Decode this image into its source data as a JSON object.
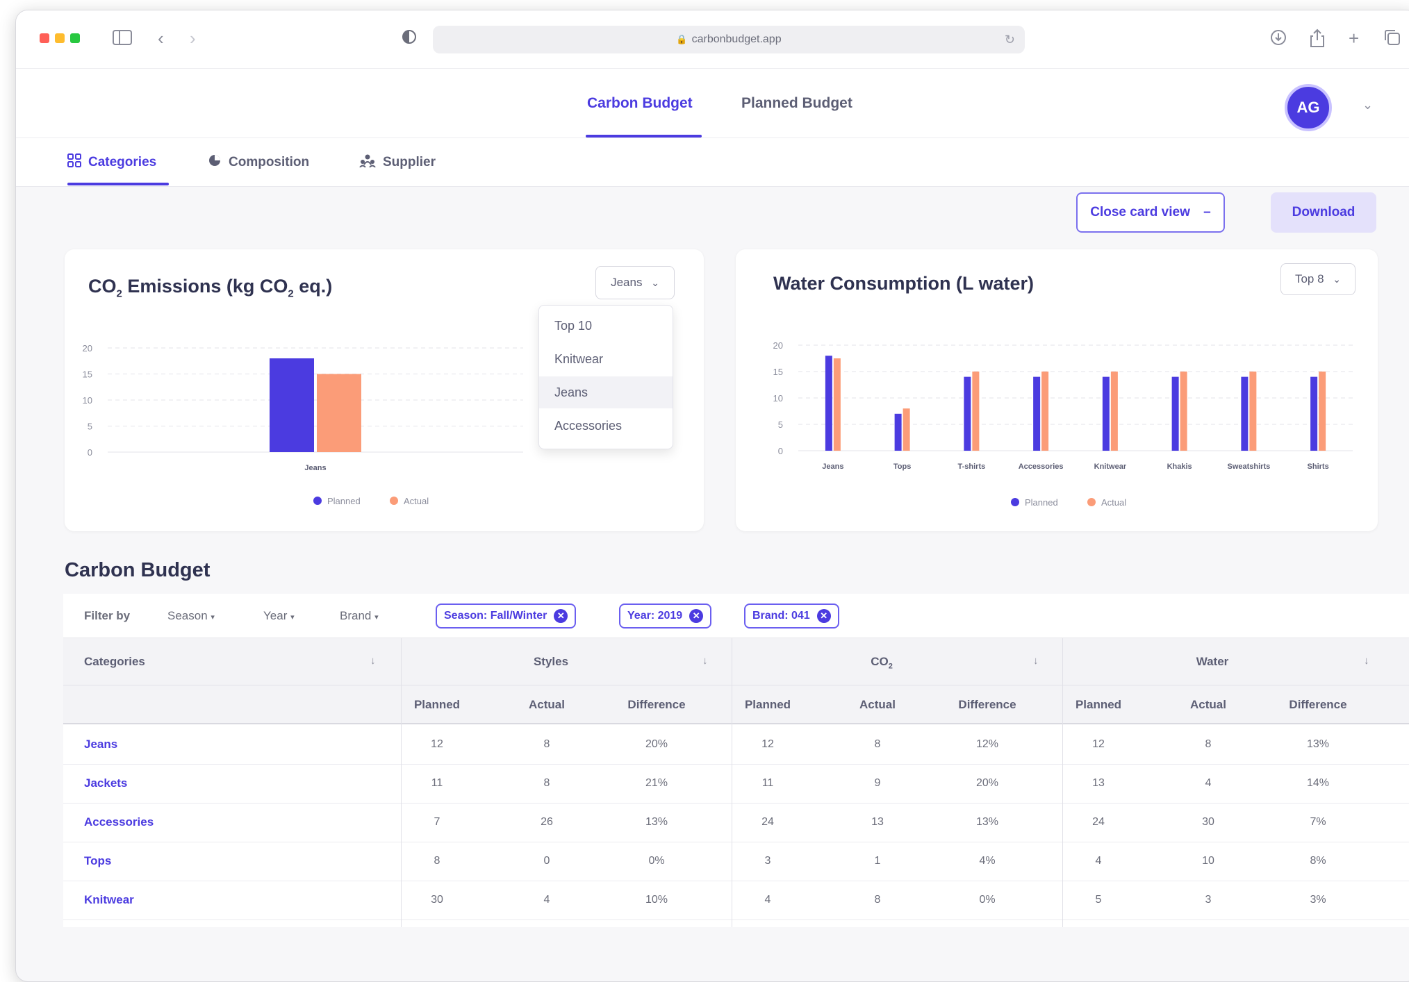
{
  "browser": {
    "url": "carbonbudget.app"
  },
  "app": {
    "nav": [
      "Carbon Budget",
      "Planned Budget"
    ],
    "avatar_initials": "AG",
    "subtabs": [
      "Categories",
      "Composition",
      "Supplier"
    ],
    "close_card_label": "Close card view",
    "download_label": "Download",
    "accent": "#4b3be0",
    "planned_color": "#4b3be0",
    "actual_color": "#fb9c78"
  },
  "co2_card": {
    "title_main": "CO",
    "title_sub": "2",
    "title_rest": " Emissions (kg CO",
    "title_sub2": "2",
    "title_end": " eq.)",
    "select_value": "Jeans",
    "dropdown": [
      "Top 10",
      "Knitwear",
      "Jeans",
      "Accessories"
    ],
    "legend": [
      "Planned",
      "Actual"
    ]
  },
  "water_card": {
    "title": "Water Consumption (L water)",
    "select_value": "Top 8",
    "legend": [
      "Planned",
      "Actual"
    ]
  },
  "chart_data": [
    {
      "type": "bar",
      "categories": [
        "Jeans"
      ],
      "series": [
        {
          "name": "Planned",
          "values": [
            18
          ]
        },
        {
          "name": "Actual",
          "values": [
            15
          ]
        }
      ],
      "ylim": [
        0,
        20
      ],
      "yticks": [
        0,
        5,
        10,
        15,
        20
      ],
      "legend": "bottom",
      "grid": true
    },
    {
      "type": "bar",
      "categories": [
        "Jeans",
        "Tops",
        "T-shirts",
        "Accessories",
        "Knitwear",
        "Khakis",
        "Sweatshirts",
        "Shirts"
      ],
      "series": [
        {
          "name": "Planned",
          "values": [
            18,
            7,
            14,
            14,
            14,
            14,
            14,
            14
          ]
        },
        {
          "name": "Actual",
          "values": [
            17.5,
            8,
            15,
            15,
            15,
            15,
            15,
            15
          ]
        }
      ],
      "ylim": [
        0,
        20
      ],
      "yticks": [
        0,
        5,
        10,
        15,
        20
      ],
      "legend": "bottom",
      "grid": true
    }
  ],
  "table": {
    "section_title": "Carbon Budget",
    "filter_label": "Filter by",
    "filters": [
      "Season",
      "Year",
      "Brand"
    ],
    "chips": [
      "Season: Fall/Winter",
      "Year: 2019",
      "Brand: 041"
    ],
    "group_headers": [
      "Categories",
      "Styles",
      "CO",
      "Water"
    ],
    "co2_sub": "2",
    "sub_headers": [
      "Planned",
      "Actual",
      "Difference"
    ],
    "rows": [
      {
        "category": "Jeans",
        "values": [
          "12",
          "8",
          "20%",
          "12",
          "8",
          "12%",
          "12",
          "8",
          "13%"
        ]
      },
      {
        "category": "Jackets",
        "values": [
          "11",
          "8",
          "21%",
          "11",
          "9",
          "20%",
          "13",
          "4",
          "14%"
        ]
      },
      {
        "category": "Accessories",
        "values": [
          "7",
          "26",
          "13%",
          "24",
          "13",
          "13%",
          "24",
          "30",
          "7%"
        ]
      },
      {
        "category": "Tops",
        "values": [
          "8",
          "0",
          "0%",
          "3",
          "1",
          "4%",
          "4",
          "10",
          "8%"
        ]
      },
      {
        "category": "Knitwear",
        "values": [
          "30",
          "4",
          "10%",
          "4",
          "8",
          "0%",
          "5",
          "3",
          "3%"
        ]
      }
    ]
  }
}
